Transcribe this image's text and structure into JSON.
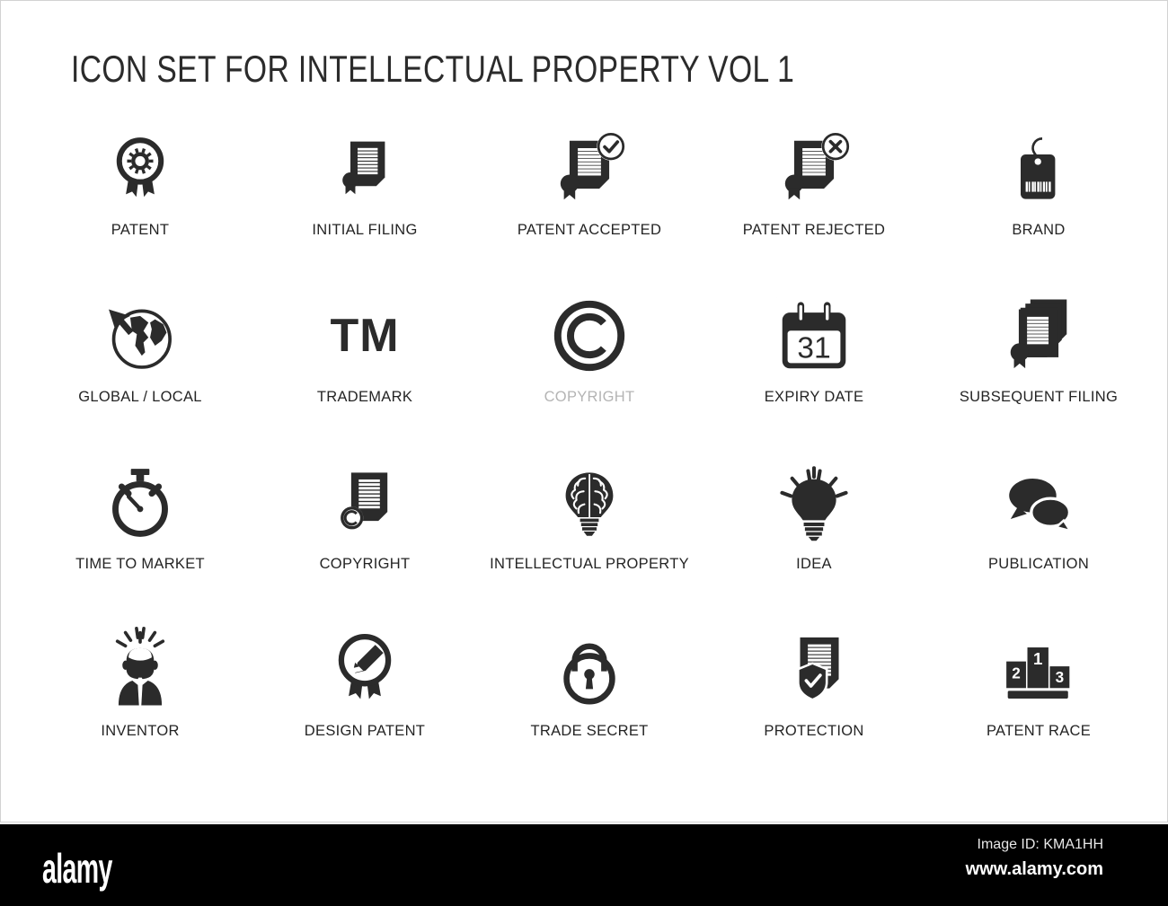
{
  "page": {
    "title": "ICON SET FOR INTELLECTUAL PROPERTY VOL 1",
    "background_color": "#ffffff",
    "icon_color": "#2b2b2b",
    "caption_color": "#242424",
    "muted_caption_color": "#b4b4b4"
  },
  "grid": {
    "columns": 5,
    "rows": 4,
    "items": [
      {
        "label": "PATENT",
        "icon": "award-ribbon-gear-icon",
        "muted": false
      },
      {
        "label": "INITIAL FILING",
        "icon": "document-seal-icon",
        "muted": false
      },
      {
        "label": "PATENT ACCEPTED",
        "icon": "document-seal-check-icon",
        "muted": false
      },
      {
        "label": "PATENT REJECTED",
        "icon": "document-seal-cross-icon",
        "muted": false
      },
      {
        "label": "BRAND",
        "icon": "price-tag-barcode-icon",
        "muted": false
      },
      {
        "label": "GLOBAL / LOCAL",
        "icon": "globe-arrow-icon",
        "muted": false
      },
      {
        "label": "TRADEMARK",
        "icon": "tm-text-icon",
        "muted": false
      },
      {
        "label": "COPYRIGHT",
        "icon": "copyright-symbol-icon",
        "muted": true
      },
      {
        "label": "EXPIRY DATE",
        "icon": "calendar-31-icon",
        "muted": false
      },
      {
        "label": "SUBSEQUENT FILING",
        "icon": "document-stack-seal-icon",
        "muted": false
      },
      {
        "label": "TIME TO MARKET",
        "icon": "stopwatch-icon",
        "muted": false
      },
      {
        "label": "COPYRIGHT",
        "icon": "document-copyright-icon",
        "muted": false
      },
      {
        "label": "INTELLECTUAL PROPERTY",
        "icon": "brain-lightbulb-icon",
        "muted": false
      },
      {
        "label": "IDEA",
        "icon": "lightbulb-rays-icon",
        "muted": false
      },
      {
        "label": "PUBLICATION",
        "icon": "speech-bubbles-icon",
        "muted": false
      },
      {
        "label": "INVENTOR",
        "icon": "person-idea-icon",
        "muted": false
      },
      {
        "label": "DESIGN PATENT",
        "icon": "award-ribbon-pencil-icon",
        "muted": false
      },
      {
        "label": "TRADE SECRET",
        "icon": "padlock-icon",
        "muted": false
      },
      {
        "label": "PROTECTION",
        "icon": "document-shield-check-icon",
        "muted": false
      },
      {
        "label": "PATENT RACE",
        "icon": "podium-123-icon",
        "muted": false
      }
    ]
  },
  "icon_text": {
    "trademark": "TM",
    "calendar_day": "31",
    "podium_first": "1",
    "podium_second": "2",
    "podium_third": "3"
  },
  "watermark": {
    "logo": "alamy",
    "image_id": "Image ID: KMA1HH",
    "url": "www.alamy.com",
    "bar_color": "#000000"
  }
}
